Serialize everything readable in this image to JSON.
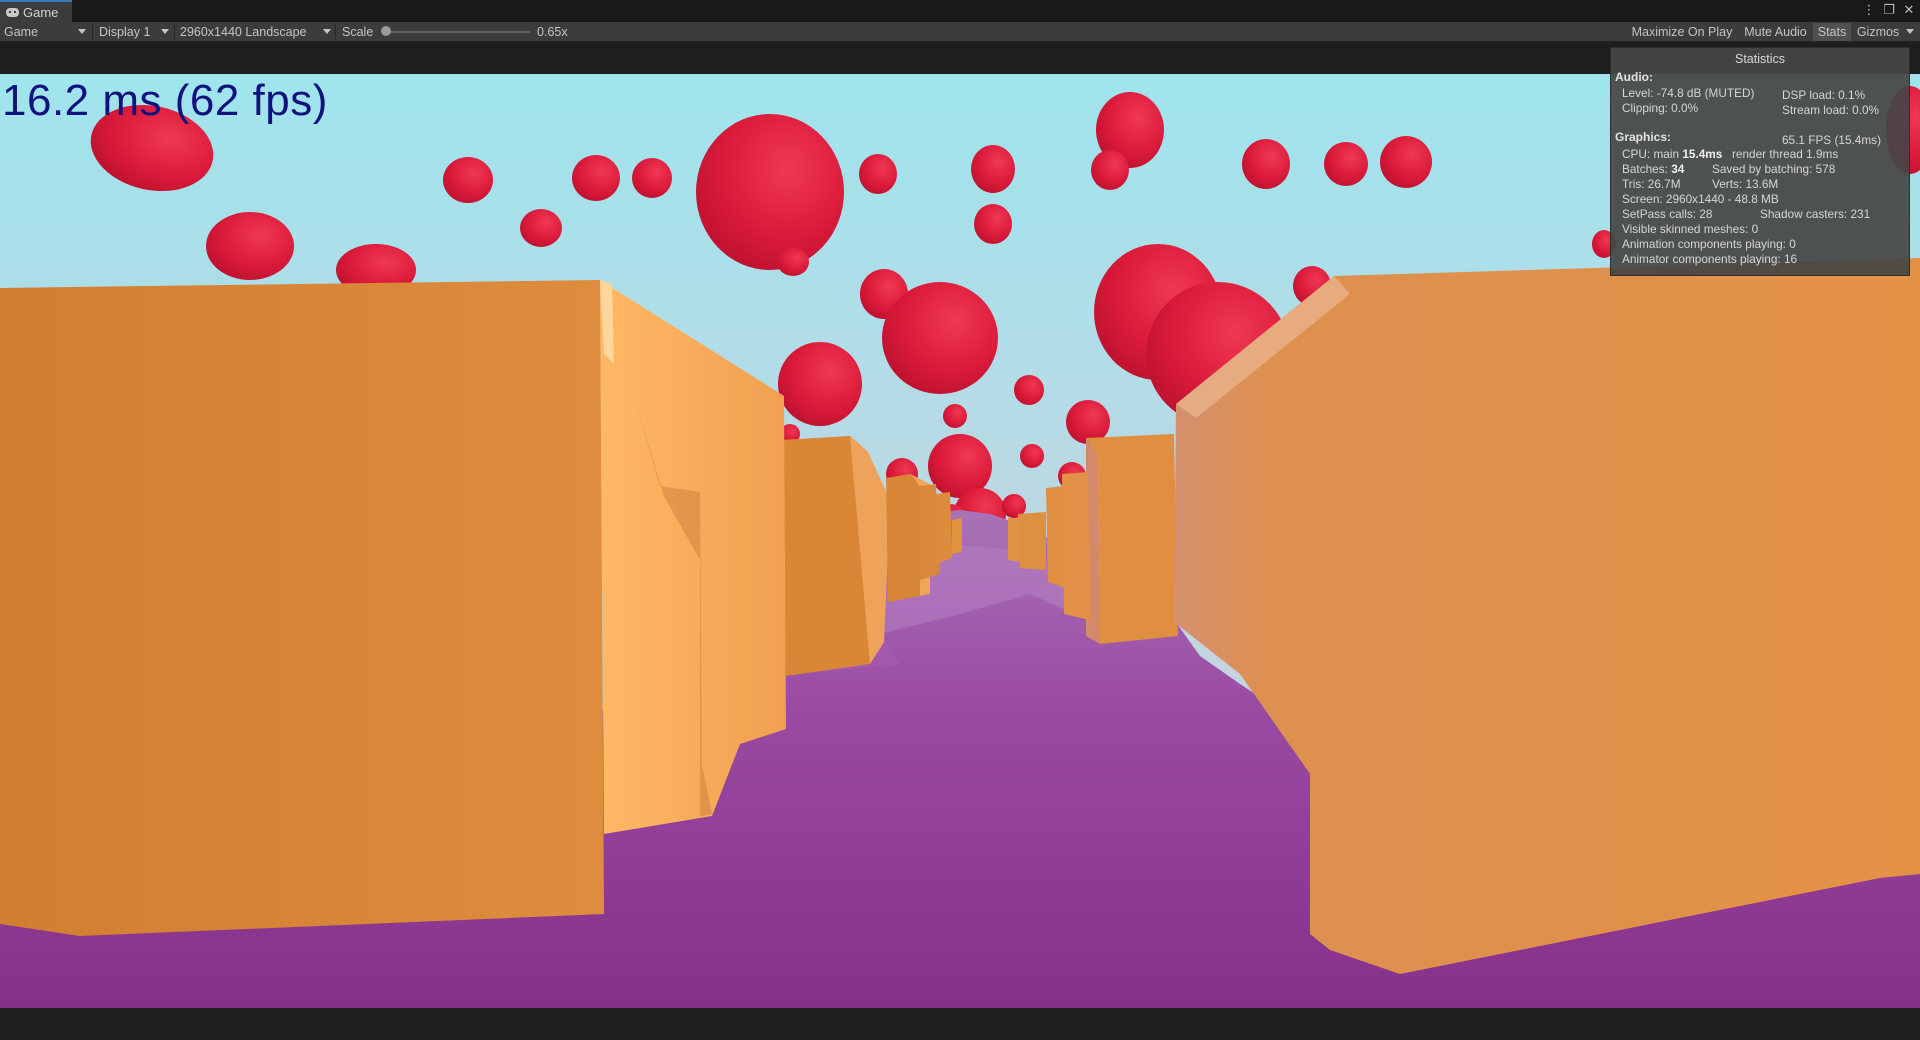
{
  "window": {
    "tab_label": "Game",
    "controls": [
      "⋮",
      "❐",
      "✕"
    ]
  },
  "toolbar": {
    "view_select": "Game",
    "display_select": "Display 1",
    "resolution_select": "2960x1440 Landscape",
    "scale_label": "Scale",
    "scale_value": "0.65x",
    "maximize_on_play": "Maximize On Play",
    "mute_audio": "Mute Audio",
    "stats": "Stats",
    "gizmos": "Gizmos"
  },
  "overlay": {
    "fps_text": "16.2 ms (62 fps)"
  },
  "statistics": {
    "title": "Statistics",
    "audio_header": "Audio:",
    "level": "Level: -74.8 dB (MUTED)",
    "dsp_load": "DSP load: 0.1%",
    "clipping": "Clipping: 0.0%",
    "stream_load": "Stream load: 0.0%",
    "graphics_header": "Graphics:",
    "fps_summary": "65.1 FPS (15.4ms)",
    "cpu_main_label": "CPU: main",
    "cpu_main_value": "15.4ms",
    "render_thread": "render thread 1.9ms",
    "batches_label": "Batches:",
    "batches_value": "34",
    "saved_by_batching": "Saved by batching: 578",
    "tris": "Tris: 26.7M",
    "verts": "Verts: 13.6M",
    "screen": "Screen: 2960x1440 - 48.8 MB",
    "setpass": "SetPass calls: 28",
    "shadow_casters": "Shadow casters: 231",
    "visible_skinned": "Visible skinned meshes: 0",
    "animation_components": "Animation components playing: 0",
    "animator_components": "Animator components playing: 16"
  },
  "colors": {
    "sky_top": "#a0e4ec",
    "sky_bottom": "#c8c8dc",
    "balloon": "#e01e3c",
    "wall": "#d98a3c",
    "floor": "#8e3e8e",
    "fps_text": "#10127e"
  }
}
